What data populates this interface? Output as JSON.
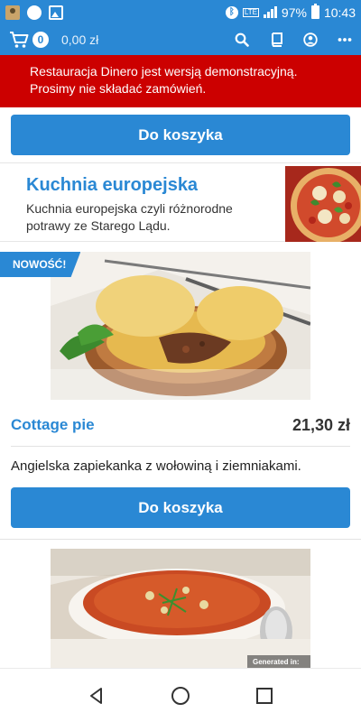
{
  "status_bar": {
    "battery": "97%",
    "time": "10:43",
    "network": "LTE",
    "icons": [
      "app-notification-icon",
      "circle-notification-icon",
      "image-notification-icon",
      "bluetooth-icon",
      "signal-icon",
      "battery-icon"
    ]
  },
  "app_bar": {
    "cart_count": "0",
    "cart_total": "0,00 zł",
    "icons": [
      "cart-icon",
      "search-icon",
      "book-icon",
      "account-icon",
      "more-icon"
    ]
  },
  "demo_notice": {
    "line1": "Restauracja Dinero jest wersją demonstracyjną.",
    "line2": "Prosimy nie składać zamówień."
  },
  "top_button": {
    "label": "Do koszyka"
  },
  "category": {
    "title": "Kuchnia europejska",
    "description": "Kuchnia europejska czyli różnorodne potrawy ze Starego Lądu."
  },
  "product": {
    "badge": "NOWOŚĆ!",
    "name": "Cottage pie",
    "price": "21,30 zł",
    "description": "Angielska zapiekanka z wołowiną i ziemniakami.",
    "button_label": "Do koszyka"
  },
  "next_product": {
    "watermark": "Generated in:"
  },
  "colors": {
    "primary": "#2a88d4",
    "danger": "#cc0000",
    "text": "#222222"
  },
  "nav_bar": {
    "icons": [
      "back-icon",
      "home-icon",
      "recents-icon"
    ]
  }
}
